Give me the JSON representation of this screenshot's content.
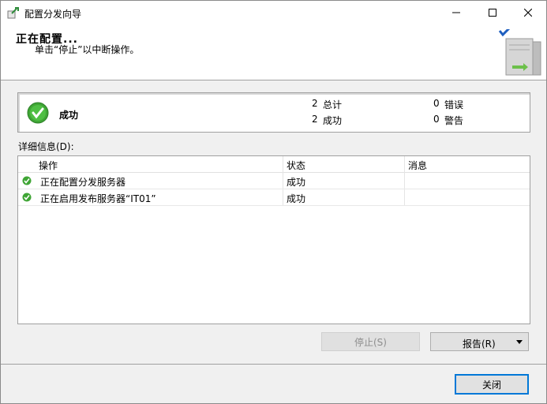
{
  "window": {
    "title": "配置分发向导"
  },
  "header": {
    "title": "正在配置...",
    "subtitle": "单击“停止”以中断操作。"
  },
  "summary": {
    "status": "成功",
    "total_count": "2",
    "total_label": "总计",
    "success_count": "2",
    "success_label": "成功",
    "error_count": "0",
    "error_label": "错误",
    "warning_count": "0",
    "warning_label": "警告"
  },
  "details": {
    "label": "详细信息(D):",
    "columns": [
      "操作",
      "状态",
      "消息"
    ],
    "rows": [
      {
        "action": "正在配置分发服务器",
        "status": "成功",
        "message": ""
      },
      {
        "action": "正在启用发布服务器“IT01”",
        "status": "成功",
        "message": ""
      }
    ]
  },
  "buttons": {
    "stop": "停止(S)",
    "report": "报告(R)",
    "close": "关闭"
  },
  "icons": {
    "app": "wizard-icon",
    "success": "check-circle-icon",
    "server": "server-icon"
  },
  "colors": {
    "success_green": "#3fa535",
    "accent_blue": "#0078d7"
  }
}
